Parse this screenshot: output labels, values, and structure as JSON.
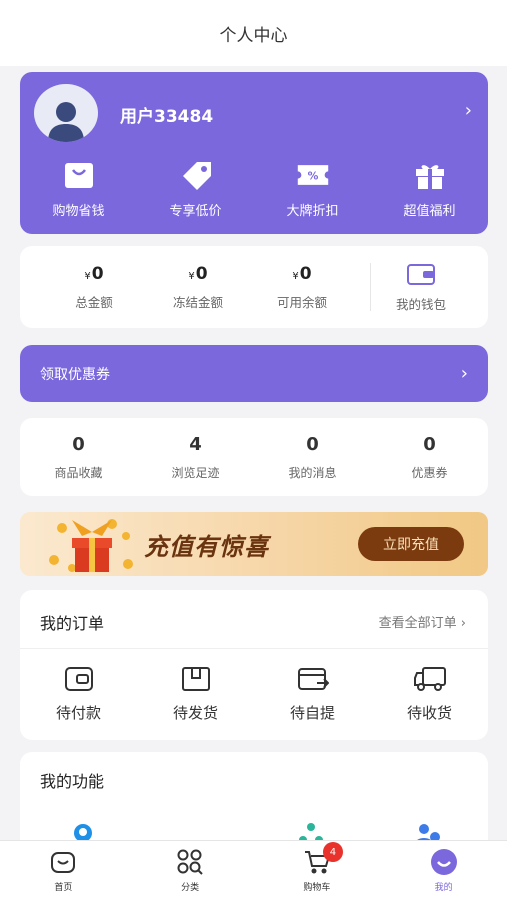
{
  "header": {
    "title": "个人中心"
  },
  "profile": {
    "username": "用户33484",
    "arrow": "›",
    "perks": [
      {
        "label": "购物省钱",
        "icon": "shopping-bag-icon"
      },
      {
        "label": "专享低价",
        "icon": "price-tag-icon"
      },
      {
        "label": "大牌折扣",
        "icon": "discount-ticket-icon"
      },
      {
        "label": "超值福利",
        "icon": "gift-icon"
      }
    ]
  },
  "wallet": {
    "currency": "¥",
    "items": [
      {
        "value": "0",
        "label": "总金额"
      },
      {
        "value": "0",
        "label": "冻结金额"
      },
      {
        "value": "0",
        "label": "可用余额"
      }
    ],
    "purse_label": "我的钱包"
  },
  "coupon_bar": {
    "label": "领取优惠券",
    "arrow": "›"
  },
  "stats": [
    {
      "value": "0",
      "label": "商品收藏"
    },
    {
      "value": "4",
      "label": "浏览足迹"
    },
    {
      "value": "0",
      "label": "我的消息"
    },
    {
      "value": "0",
      "label": "优惠券"
    }
  ],
  "banner": {
    "title": "充值有惊喜",
    "button": "立即充值"
  },
  "orders": {
    "title": "我的订单",
    "view_all": "查看全部订单 ›",
    "items": [
      {
        "label": "待付款",
        "icon": "wallet-card-icon"
      },
      {
        "label": "待发货",
        "icon": "package-box-icon"
      },
      {
        "label": "待自提",
        "icon": "pickup-card-icon"
      },
      {
        "label": "待收货",
        "icon": "delivery-truck-icon"
      }
    ]
  },
  "functions": {
    "title": "我的功能"
  },
  "nav": {
    "items": [
      {
        "label": "首页",
        "icon": "home-icon"
      },
      {
        "label": "分类",
        "icon": "category-grid-icon"
      },
      {
        "label": "购物车",
        "icon": "cart-icon",
        "badge": "4"
      },
      {
        "label": "我的",
        "icon": "profile-face-icon",
        "active": true
      }
    ]
  },
  "colors": {
    "accent": "#7a68dc",
    "badge": "#e8322b",
    "banner_text": "#6b3410"
  }
}
